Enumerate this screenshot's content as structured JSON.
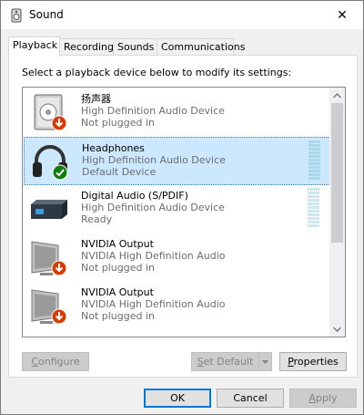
{
  "window": {
    "title": "Sound",
    "close_glyph": "✕"
  },
  "tabs": [
    {
      "label": "Playback",
      "active": true
    },
    {
      "label": "Recording",
      "active": false
    },
    {
      "label": "Sounds",
      "active": false
    },
    {
      "label": "Communications",
      "active": false
    }
  ],
  "instructions": "Select a playback device below to modify its settings:",
  "devices": [
    {
      "name": "扬声器",
      "driver": "High Definition Audio Device",
      "status": "Not plugged in",
      "icon": "speaker-icon",
      "badge": "not-plugged-badge-icon",
      "selected": false
    },
    {
      "name": "Headphones",
      "driver": "High Definition Audio Device",
      "status": "Default Device",
      "icon": "headphones-icon",
      "badge": "default-check-badge-icon",
      "selected": true
    },
    {
      "name": "Digital Audio (S/PDIF)",
      "driver": "High Definition Audio Device",
      "status": "Ready",
      "icon": "digital-audio-icon",
      "badge": "",
      "selected": false
    },
    {
      "name": "NVIDIA Output",
      "driver": "NVIDIA High Definition Audio",
      "status": "Not plugged in",
      "icon": "monitor-icon",
      "badge": "not-plugged-badge-icon",
      "selected": false
    },
    {
      "name": "NVIDIA Output",
      "driver": "NVIDIA High Definition Audio",
      "status": "Not plugged in",
      "icon": "monitor-icon",
      "badge": "not-plugged-badge-icon",
      "selected": false
    }
  ],
  "buttons": {
    "configure": {
      "label": "Configure",
      "mnemonic": "C",
      "rest": "onfigure"
    },
    "set_default": {
      "label": "Set Default",
      "mnemonic": "S",
      "rest": "et Default"
    },
    "properties": {
      "label": "Properties",
      "mnemonic": "P",
      "rest": "roperties"
    },
    "ok": "OK",
    "cancel": "Cancel",
    "apply": {
      "label": "Apply",
      "mnemonic": "A",
      "rest": "pply"
    }
  },
  "colors": {
    "selection": "#cce8ff",
    "meter": "#a8d8ea",
    "badge_red": "#d83b01",
    "badge_green": "#107c10"
  }
}
